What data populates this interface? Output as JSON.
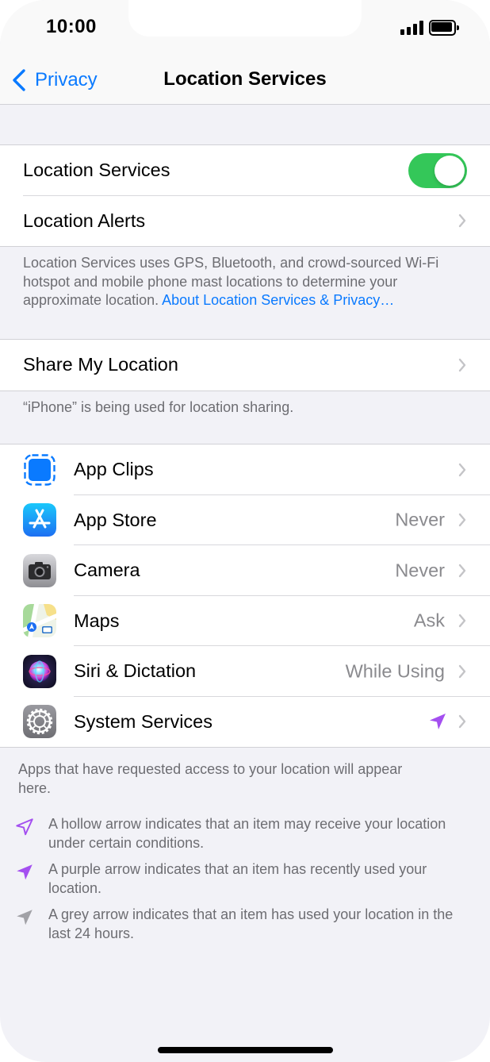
{
  "status_bar": {
    "time": "10:00"
  },
  "nav": {
    "back_label": "Privacy",
    "title": "Location Services"
  },
  "group1": {
    "location_services_label": "Location Services",
    "location_services_enabled": true,
    "location_alerts_label": "Location Alerts"
  },
  "footer1": {
    "text": "Location Services uses GPS, Bluetooth, and crowd-sourced Wi-Fi hotspot and mobile phone mast locations to determine your approximate location. ",
    "link": "About Location Services & Privacy…"
  },
  "group2": {
    "share_label": "Share My Location"
  },
  "footer2": {
    "text": "“iPhone” is being used for location sharing."
  },
  "apps": [
    {
      "name": "App Clips",
      "value": "",
      "icon": "app-clips-icon"
    },
    {
      "name": "App Store",
      "value": "Never",
      "icon": "app-store-icon"
    },
    {
      "name": "Camera",
      "value": "Never",
      "icon": "camera-icon"
    },
    {
      "name": "Maps",
      "value": "Ask",
      "icon": "maps-icon"
    },
    {
      "name": "Siri & Dictation",
      "value": "While Using",
      "icon": "siri-icon"
    },
    {
      "name": "System Services",
      "value": "",
      "icon": "system-services-icon",
      "indicator": "purple-location-arrow-icon"
    }
  ],
  "footer3": {
    "text": "Apps that have requested access to your location will appear here."
  },
  "legend": [
    {
      "icon": "hollow-arrow-icon",
      "text": "A hollow arrow indicates that an item may receive your location under certain conditions."
    },
    {
      "icon": "purple-arrow-icon",
      "text": "A purple arrow indicates that an item has recently used your location."
    },
    {
      "icon": "grey-arrow-icon",
      "text": "A grey arrow indicates that an item has used your location in the last 24 hours."
    }
  ],
  "colors": {
    "accent": "#0a7aff",
    "toggle_on": "#34c759",
    "purple_arrow": "#a44ff0",
    "grey_arrow": "#a1a1a6",
    "grouped_background": "#f2f2f7"
  }
}
